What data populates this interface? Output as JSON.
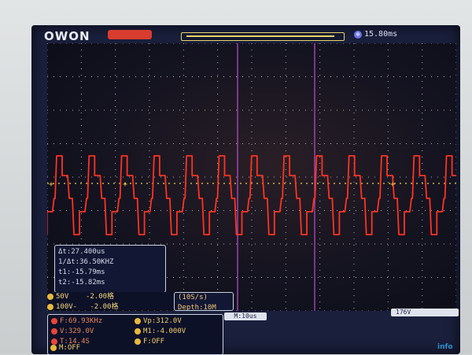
{
  "header": {
    "brand": "OWON",
    "run_status": "",
    "trigger_delay": "15.80ms"
  },
  "cursors": {
    "delta_t": "Δt:27.400us",
    "inv_delta_t": "1/Δt:36.50KHZ",
    "t1": "t1:-15.79ms",
    "t2": "t2:-15.82ms"
  },
  "channels": [
    {
      "name": "ch1",
      "volt": "50V",
      "offset": "-2.00格"
    },
    {
      "name": "ch2",
      "volt": "100V-",
      "offset": "-2.00格"
    }
  ],
  "acquisition": {
    "sample_rate": "(10S/s)",
    "depth": "Depth:10M"
  },
  "timebase": "M:10us",
  "trigger": "176V",
  "measurements": {
    "left": [
      "F:69.93KHz",
      "V:329.0V",
      "T:14.4S"
    ],
    "right": [
      "Vp:312.0V",
      "M1:-4.000V",
      "F:OFF"
    ],
    "bottom": "M:OFF"
  },
  "watermark": "info",
  "colors": {
    "trace": "#ff3322",
    "grid": "#e6e6e6",
    "cursor": "#c24ad6",
    "trigger_marker": "#f0d24a"
  }
}
